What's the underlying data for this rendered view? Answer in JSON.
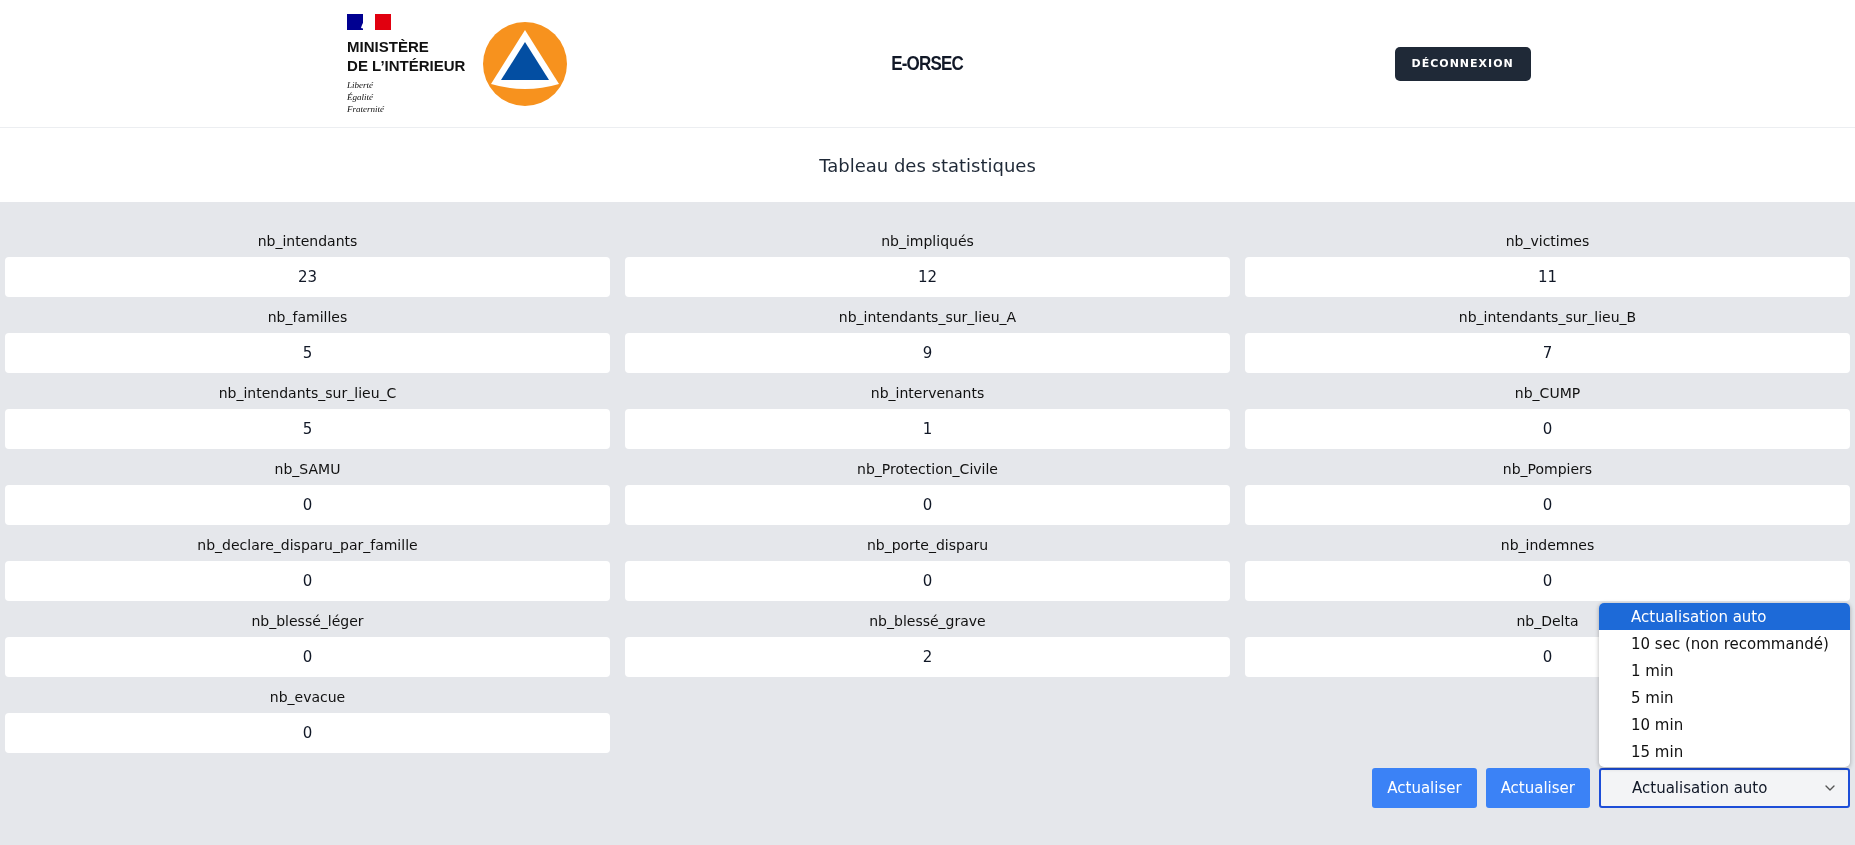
{
  "header": {
    "ministry": {
      "name_lines": [
        "MINISTÈRE",
        "DE L’INTÉRIEUR"
      ],
      "motto": [
        "Liberté",
        "Égalité",
        "Fraternité"
      ]
    },
    "title": "E-ORSEC",
    "logout_button": "DÉCONNEXION"
  },
  "page_title": "Tableau des statistiques",
  "stats": [
    {
      "label": "nb_intendants",
      "value": "23"
    },
    {
      "label": "nb_impliqués",
      "value": "12"
    },
    {
      "label": "nb_victimes",
      "value": "11"
    },
    {
      "label": "nb_familles",
      "value": "5"
    },
    {
      "label": "nb_intendants_sur_lieu_A",
      "value": "9"
    },
    {
      "label": "nb_intendants_sur_lieu_B",
      "value": "7"
    },
    {
      "label": "nb_intendants_sur_lieu_C",
      "value": "5"
    },
    {
      "label": "nb_intervenants",
      "value": "1"
    },
    {
      "label": "nb_CUMP",
      "value": "0"
    },
    {
      "label": "nb_SAMU",
      "value": "0"
    },
    {
      "label": "nb_Protection_Civile",
      "value": "0"
    },
    {
      "label": "nb_Pompiers",
      "value": "0"
    },
    {
      "label": "nb_declare_disparu_par_famille",
      "value": "0"
    },
    {
      "label": "nb_porte_disparu",
      "value": "0"
    },
    {
      "label": "nb_indemnes",
      "value": "0"
    },
    {
      "label": "nb_blessé_léger",
      "value": "0"
    },
    {
      "label": "nb_blessé_grave",
      "value": "2"
    },
    {
      "label": "nb_Delta",
      "value": "0"
    },
    {
      "label": "nb_evacue",
      "value": "0"
    }
  ],
  "footer": {
    "buttons": [
      "Actualiser",
      "Actualiser"
    ],
    "refresh_select": {
      "value": "Actualisation auto",
      "expanded": true,
      "options": [
        {
          "label": "Actualisation auto",
          "selected": true
        },
        {
          "label": "10 sec (non recommandé)",
          "selected": false
        },
        {
          "label": "1 min",
          "selected": false
        },
        {
          "label": "5 min",
          "selected": false
        },
        {
          "label": "10 min",
          "selected": false
        },
        {
          "label": "15 min",
          "selected": false
        }
      ]
    }
  }
}
